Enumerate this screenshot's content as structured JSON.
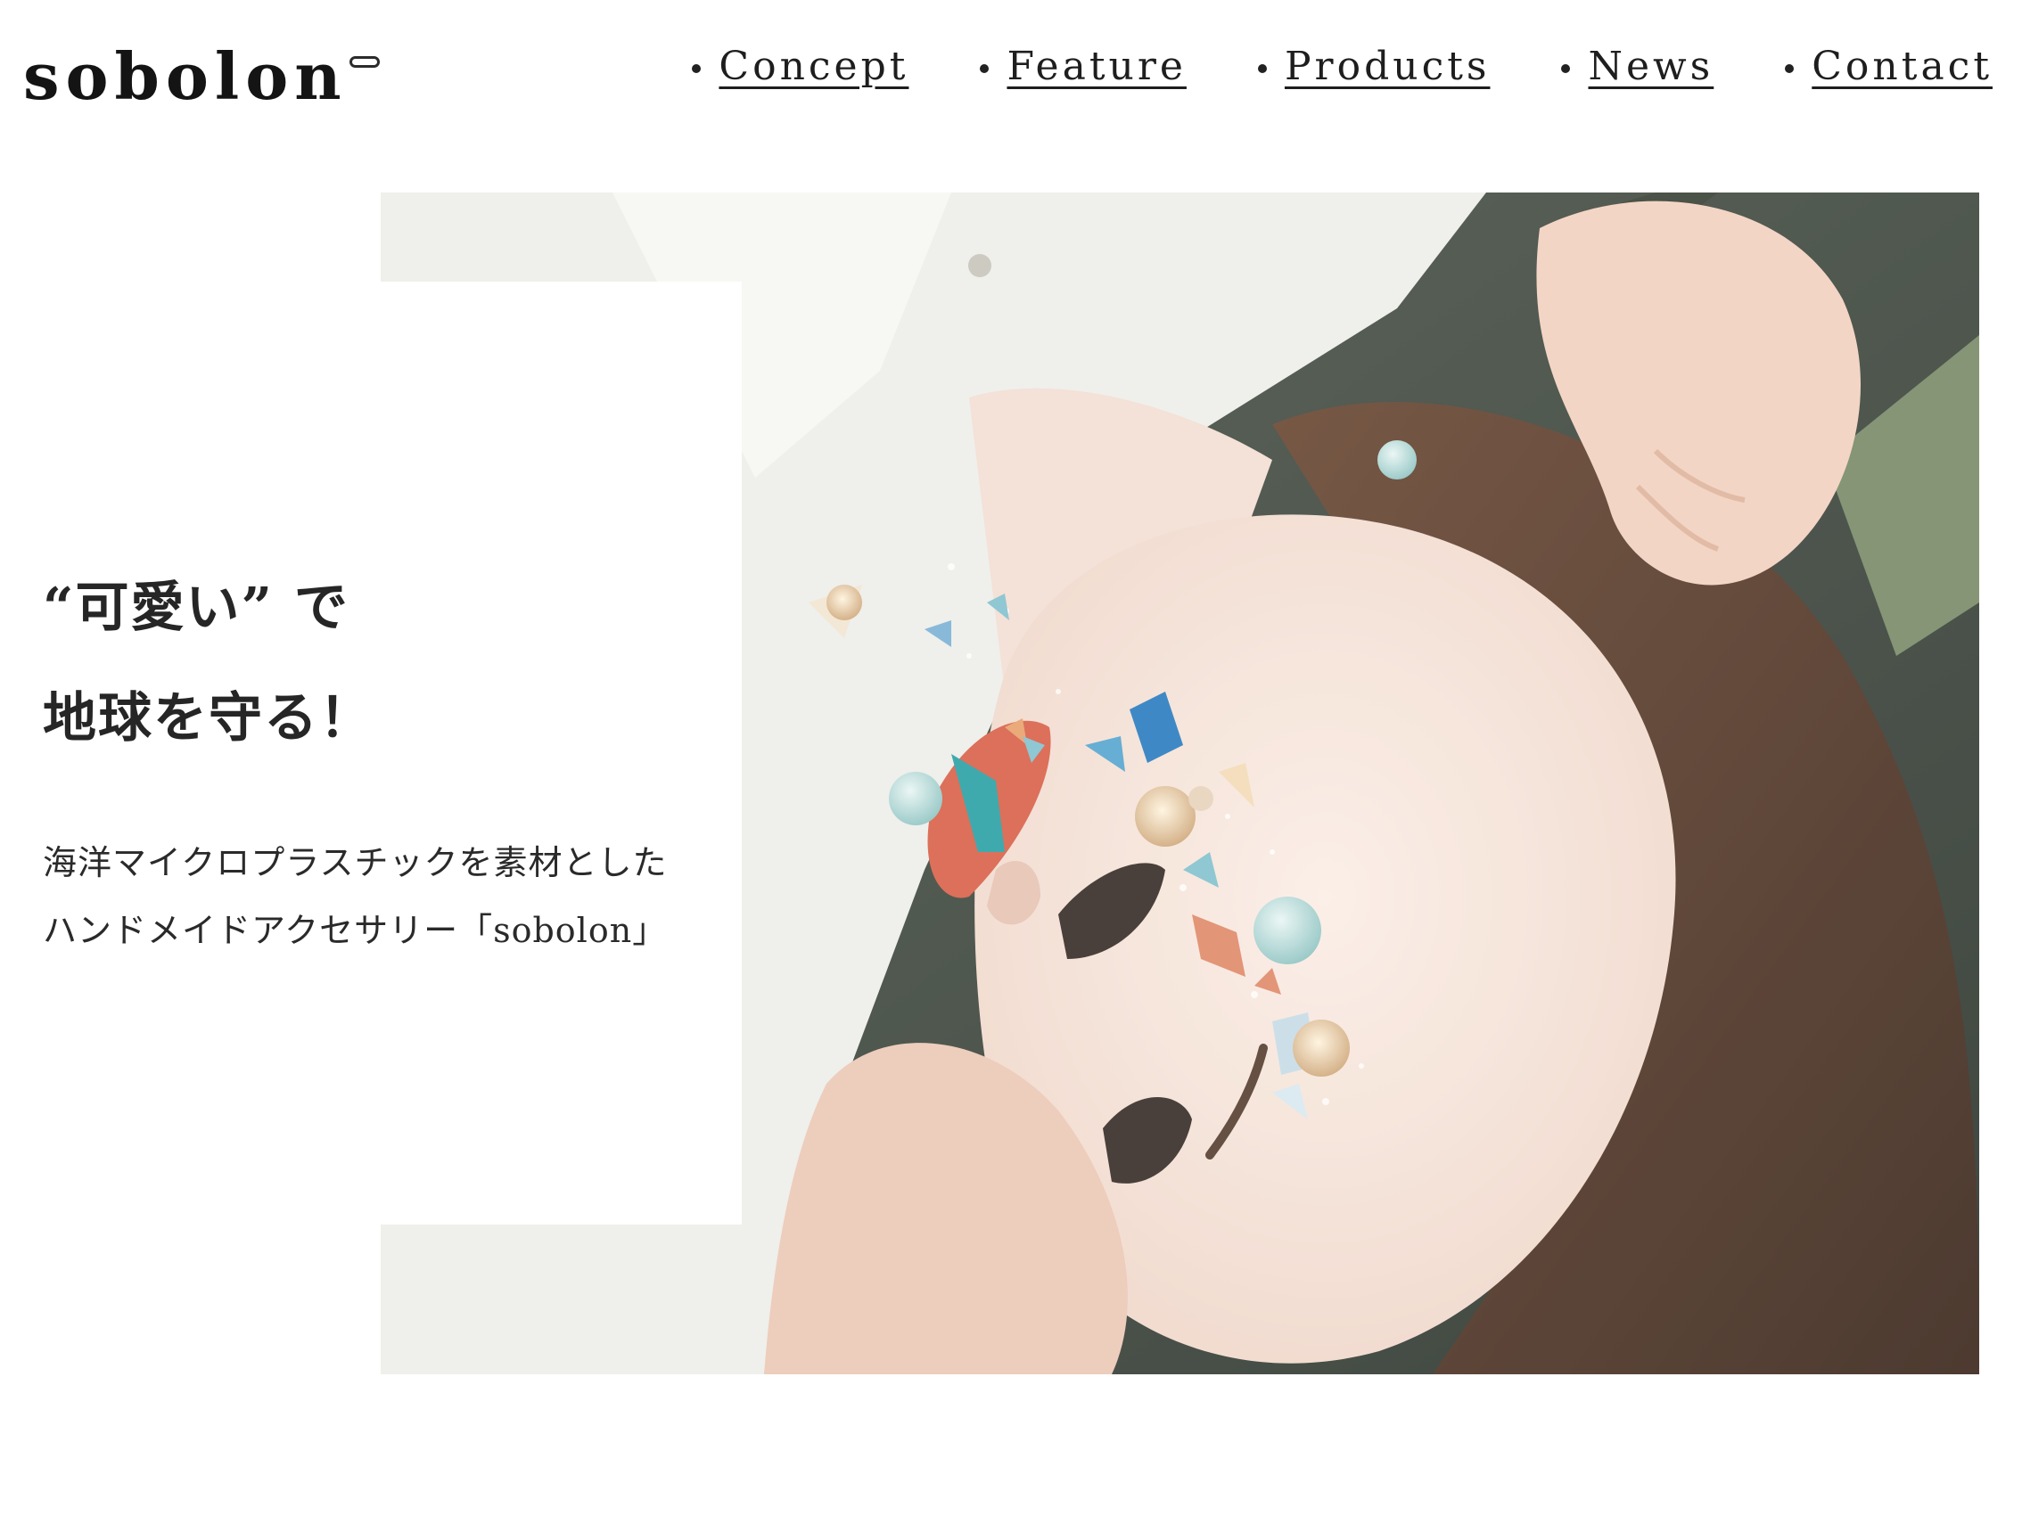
{
  "header": {
    "logo_text": "sobolon",
    "nav": [
      {
        "label": "Concept"
      },
      {
        "label": "Feature"
      },
      {
        "label": "Products"
      },
      {
        "label": "News"
      },
      {
        "label": "Contact"
      }
    ]
  },
  "hero": {
    "headline_line1": "“可愛い” で",
    "headline_line2": "地球を守る！",
    "subcopy_line1": "海洋マイクロプラスチックを素材とした",
    "subcopy_line2": "ハンドメイドアクセサリー「sobolon」"
  },
  "colors": {
    "text": "#1c1c1c",
    "background": "#ffffff"
  }
}
